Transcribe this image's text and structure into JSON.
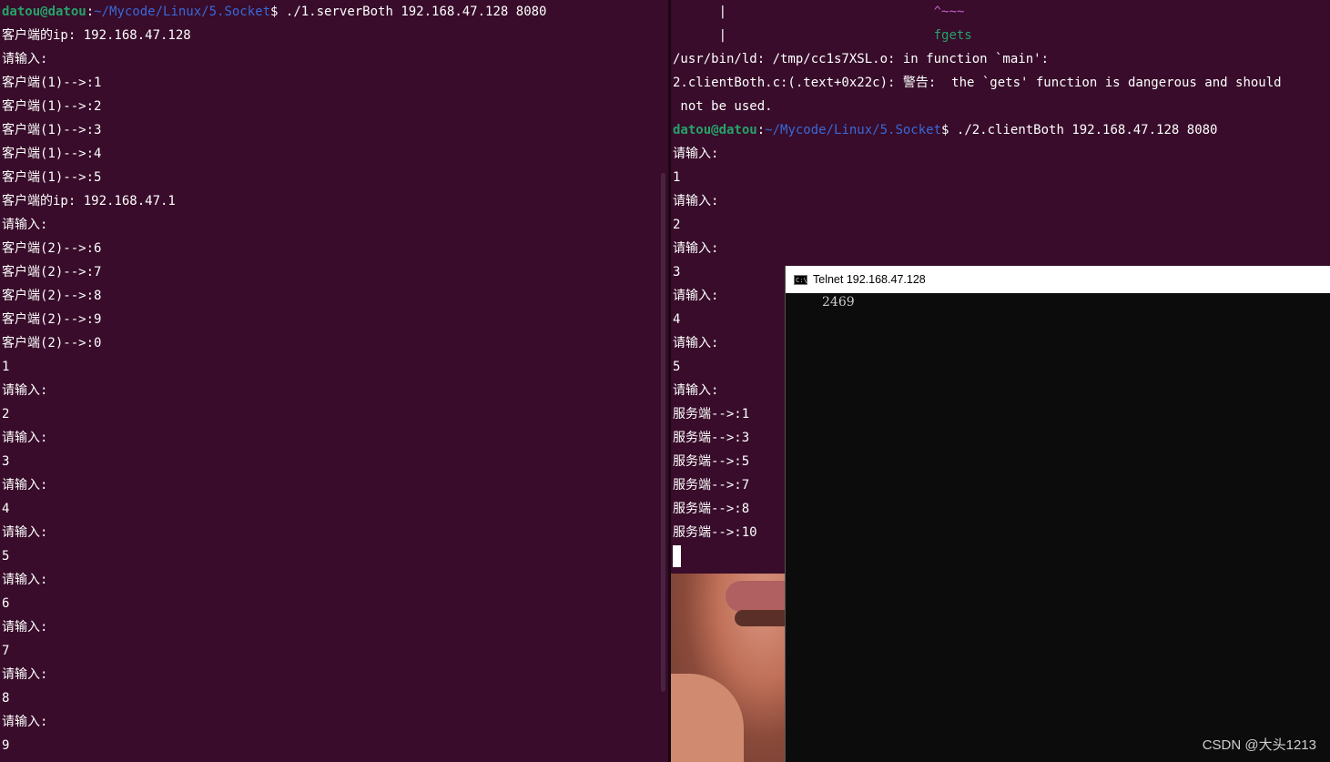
{
  "left_terminal": {
    "prompt": {
      "user": "datou@datou",
      "colon": ":",
      "path": "~/Mycode/Linux/5.Socket",
      "dollar": "$",
      "command": " ./1.serverBoth 192.168.47.128 8080"
    },
    "lines": [
      "客户端的ip: 192.168.47.128",
      "请输入:",
      "客户端(1)-->:1",
      "客户端(1)-->:2",
      "客户端(1)-->:3",
      "客户端(1)-->:4",
      "客户端(1)-->:5",
      "客户端的ip: 192.168.47.1",
      "请输入:",
      "客户端(2)-->:6",
      "客户端(2)-->:7",
      "客户端(2)-->:8",
      "客户端(2)-->:9",
      "客户端(2)-->:0",
      "1",
      "请输入:",
      "2",
      "请输入:",
      "3",
      "请输入:",
      "4",
      "请输入:",
      "5",
      "请输入:",
      "6",
      "请输入:",
      "7",
      "请输入:",
      "8",
      "请输入:",
      "9"
    ]
  },
  "right_terminal": {
    "warn_line1": {
      "bar": "      |",
      "pad": "                           ",
      "caret": "^~~~"
    },
    "warn_line2": {
      "bar": "      |",
      "pad": "                           ",
      "fn": "fgets"
    },
    "ld_lines": [
      "/usr/bin/ld: /tmp/cc1s7XSL.o: in function `main':",
      "2.clientBoth.c:(.text+0x22c): 警告:  the `gets' function is dangerous and should",
      " not be used."
    ],
    "prompt": {
      "user": "datou@datou",
      "colon": ":",
      "path": "~/Mycode/Linux/5.Socket",
      "dollar": "$",
      "command": " ./2.clientBoth 192.168.47.128 8080"
    },
    "lines": [
      "请输入:",
      "1",
      "请输入:",
      "2",
      "请输入:",
      "3",
      "请输入:",
      "4",
      "请输入:",
      "5",
      "请输入:",
      "服务端-->:1",
      "服务端-->:3",
      "服务端-->:5",
      "服务端-->:7",
      "服务端-->:8",
      "服务端-->:10"
    ]
  },
  "telnet": {
    "icon_text": "C:\\",
    "title": "Telnet 192.168.47.128",
    "content": "2469"
  },
  "watermark": "CSDN @大头1213",
  "colors": {
    "terminal_bg": "#380c2a",
    "prompt_user": "#26a269",
    "prompt_path": "#3a68d8",
    "warning_caret": "#c061cb",
    "telnet_bg": "#0c0c0c"
  }
}
